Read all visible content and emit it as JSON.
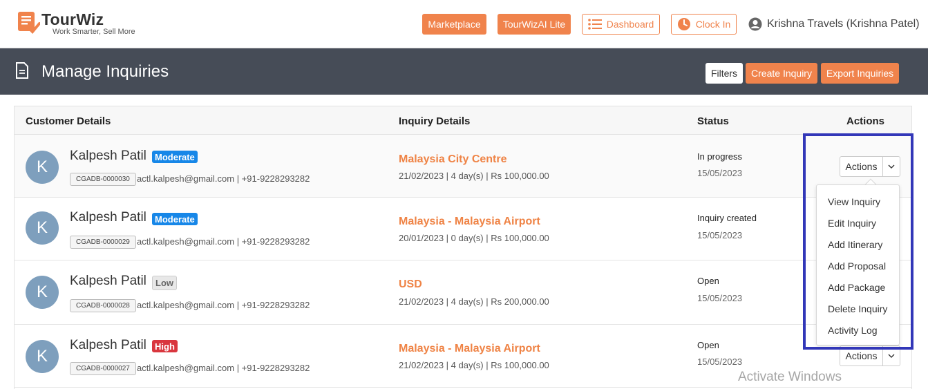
{
  "brand": {
    "name": "TourWiz",
    "tagline": "Work Smarter, Sell More"
  },
  "header": {
    "marketplace": "Marketplace",
    "ai": "TourWizAI Lite",
    "dashboard": "Dashboard",
    "clock_in": "Clock In",
    "user": "Krishna Travels (Krishna Patel)"
  },
  "page": {
    "title": "Manage Inquiries",
    "filters": "Filters",
    "create": "Create Inquiry",
    "export": "Export Inquiries"
  },
  "table": {
    "headers": {
      "customer": "Customer Details",
      "inquiry": "Inquiry Details",
      "status": "Status",
      "actions": "Actions"
    },
    "rows": [
      {
        "initial": "K",
        "name": "Kalpesh Patil",
        "priority": "Moderate",
        "code": "CGADB-0000030",
        "contact": "actl.kalpesh@gmail.com | +91-9228293282",
        "destination": "Malaysia City Centre",
        "meta": "21/02/2023 | 4 day(s) | Rs 100,000.00",
        "status": "In progress",
        "date": "15/05/2023",
        "action": "Actions"
      },
      {
        "initial": "K",
        "name": "Kalpesh Patil",
        "priority": "Moderate",
        "code": "CGADB-0000029",
        "contact": "actl.kalpesh@gmail.com | +91-9228293282",
        "destination": "Malaysia - Malaysia Airport",
        "meta": "20/01/2023 | 0 day(s) | Rs 100,000.00",
        "status": "Inquiry created",
        "date": "15/05/2023"
      },
      {
        "initial": "K",
        "name": "Kalpesh Patil",
        "priority": "Low",
        "code": "CGADB-0000028",
        "contact": "actl.kalpesh@gmail.com | +91-9228293282",
        "destination": "USD",
        "meta": "21/02/2023 | 4 day(s) | Rs 200,000.00",
        "status": "Open",
        "date": "15/05/2023"
      },
      {
        "initial": "K",
        "name": "Kalpesh Patil",
        "priority": "High",
        "code": "CGADB-0000027",
        "contact": "actl.kalpesh@gmail.com | +91-9228293282",
        "destination": "Malaysia - Malaysia Airport",
        "meta": "21/02/2023 | 4 day(s) | Rs 100,000.00",
        "status": "Open",
        "date": "15/05/2023",
        "action": "Actions"
      }
    ]
  },
  "actions_menu": {
    "items": [
      "View Inquiry",
      "Edit Inquiry",
      "Add Itinerary",
      "Add Proposal",
      "Add Package",
      "Delete Inquiry",
      "Activity Log"
    ]
  },
  "watermark": "Activate Windows",
  "colors": {
    "accent": "#f0834c",
    "titlebar": "#464c57",
    "moderate": "#1787e8",
    "high": "#d9363e",
    "highlight": "#3237b8"
  }
}
